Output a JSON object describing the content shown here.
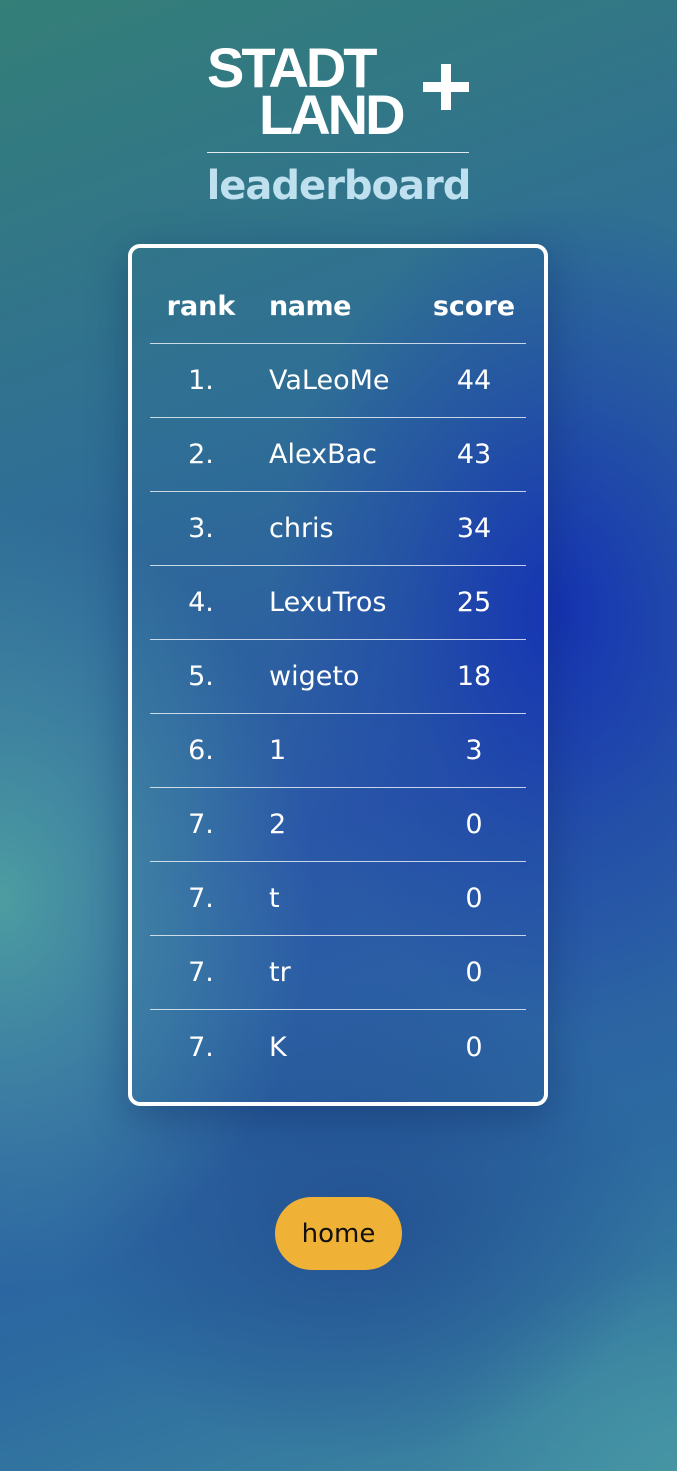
{
  "logo": {
    "line1": "STADT",
    "line2": "LAND",
    "plus_icon": "plus-icon"
  },
  "page": {
    "title": "leaderboard"
  },
  "leaderboard": {
    "headers": {
      "rank": "rank",
      "name": "name",
      "score": "score"
    },
    "rows": [
      {
        "rank": "1.",
        "name": "VaLeoMe",
        "score": "44"
      },
      {
        "rank": "2.",
        "name": "AlexBac",
        "score": "43"
      },
      {
        "rank": "3.",
        "name": "chris",
        "score": "34"
      },
      {
        "rank": "4.",
        "name": "LexuTros",
        "score": "25"
      },
      {
        "rank": "5.",
        "name": "wigeto",
        "score": "18"
      },
      {
        "rank": "6.",
        "name": "1",
        "score": "3"
      },
      {
        "rank": "7.",
        "name": "2",
        "score": "0"
      },
      {
        "rank": "7.",
        "name": "t",
        "score": "0"
      },
      {
        "rank": "7.",
        "name": "tr",
        "score": "0"
      },
      {
        "rank": "7.",
        "name": "K",
        "score": "0"
      }
    ]
  },
  "actions": {
    "home_label": "home"
  },
  "colors": {
    "accent_button": "#f0b236",
    "title_text": "#bfe0ee",
    "card_border": "#ffffff"
  }
}
